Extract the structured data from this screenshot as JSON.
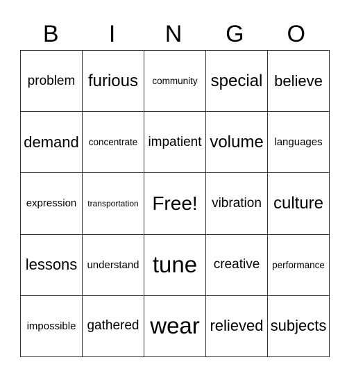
{
  "header": {
    "letters": [
      "B",
      "I",
      "N",
      "G",
      "O"
    ]
  },
  "card": {
    "rows": [
      [
        "problem",
        "furious",
        "community",
        "special",
        "believe"
      ],
      [
        "demand",
        "concentrate",
        "impatient",
        "volume",
        "languages"
      ],
      [
        "expression",
        "transportation",
        "Free!",
        "vibration",
        "culture"
      ],
      [
        "lessons",
        "understand",
        "tune",
        "creative",
        "performance"
      ],
      [
        "impossible",
        "gathered",
        "wear",
        "relieved",
        "subjects"
      ]
    ]
  }
}
